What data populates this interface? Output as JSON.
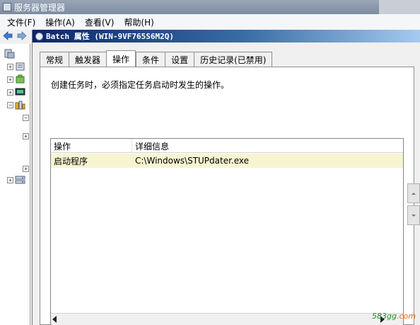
{
  "window": {
    "title": "服务器管理器"
  },
  "menu": {
    "items": [
      "文件(F)",
      "操作(A)",
      "查看(V)",
      "帮助(H)"
    ]
  },
  "dialog": {
    "title": "Batch 属性 (WIN-9VF765S6M2Q)",
    "tabs": [
      {
        "label": "常规",
        "active": false
      },
      {
        "label": "触发器",
        "active": false
      },
      {
        "label": "操作",
        "active": true
      },
      {
        "label": "条件",
        "active": false
      },
      {
        "label": "设置",
        "active": false
      },
      {
        "label": "历史记录(已禁用)",
        "active": false
      }
    ],
    "description": "创建任务时，必须指定任务启动时发生的操作。",
    "table": {
      "columns": [
        "操作",
        "详细信息"
      ],
      "rows": [
        {
          "action": "启动程序",
          "details": "C:\\Windows\\STUPdater.exe"
        }
      ]
    }
  },
  "watermark": {
    "text": "583gg",
    "suffix": ".com"
  },
  "colors": {
    "row_highlight": "#f7f4d0",
    "title_bar": "#0a246a"
  }
}
